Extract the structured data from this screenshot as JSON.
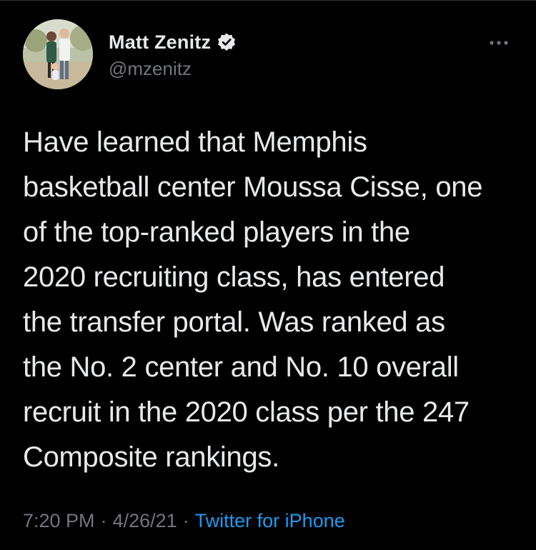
{
  "author": {
    "display_name": "Matt Zenitz",
    "handle": "@mzenitz",
    "verified": true
  },
  "tweet": {
    "text_lines": [
      "Have learned that Memphis",
      "basketball center Moussa Cisse, one",
      "of the top-ranked players in the",
      "2020 recruiting class, has entered",
      "the transfer portal. Was ranked as",
      "the No. 2 center and No. 10 overall",
      "recruit in the 2020 class per the 247",
      "Composite rankings."
    ],
    "time": "7:20 PM",
    "separator": "·",
    "date": "4/26/21",
    "source": "Twitter for iPhone"
  },
  "icons": {
    "verified": "verified-badge-icon",
    "more": "more-options-icon"
  },
  "colors": {
    "background": "#000000",
    "primary_text": "#e7e9ea",
    "secondary_text": "#71767b",
    "link": "#1d9bf0"
  }
}
